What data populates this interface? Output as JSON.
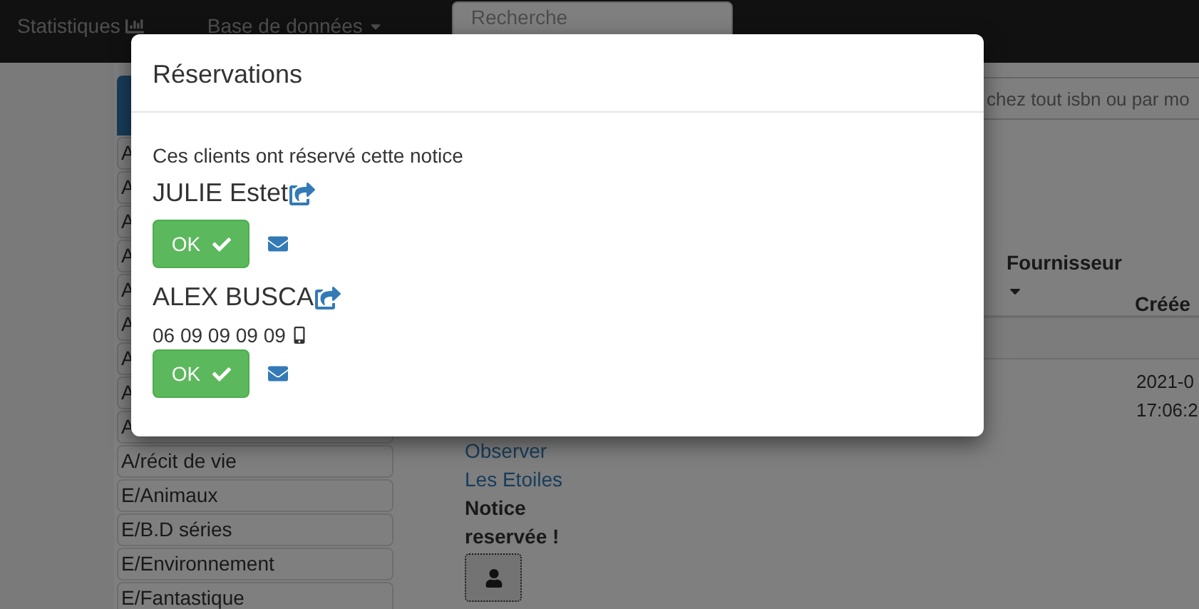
{
  "navbar": {
    "items": [
      {
        "label": "Statistiques",
        "kind": "chart"
      },
      {
        "label": "Base de données",
        "kind": "dropdown"
      }
    ],
    "search": {
      "placeholder": "Recherche"
    }
  },
  "sidebar": {
    "items": [
      {
        "label": "A"
      },
      {
        "label": "A"
      },
      {
        "label": "A"
      },
      {
        "label": "A"
      },
      {
        "label": "A"
      },
      {
        "label": "A"
      },
      {
        "label": "A"
      },
      {
        "label": "A"
      },
      {
        "label": "A"
      },
      {
        "label": "A/récit de vie"
      },
      {
        "label": "E/Animaux"
      },
      {
        "label": "E/B.D séries"
      },
      {
        "label": "E/Environnement"
      },
      {
        "label": "E/Fantastique"
      }
    ]
  },
  "main": {
    "search": {
      "placeholder": "chez tout isbn ou par mo"
    },
    "table": {
      "columns": [
        {
          "label": "Fournisseur",
          "caret": true
        },
        {
          "label": "Créée",
          "caret": false
        }
      ],
      "rows": [
        {
          "links": [
            "Observer",
            "Les Etoiles"
          ],
          "note": "Notice reservée !",
          "created": [
            "2021-0",
            "17:06:2"
          ]
        }
      ]
    }
  },
  "modal": {
    "title": "Réservations",
    "intro": "Ces clients ont réservé cette notice",
    "clients": [
      {
        "name": "JULIE Estet",
        "ok": "OK"
      },
      {
        "name": "ALEX BUSCA",
        "phone": "06 09 09 09 09",
        "ok": "OK"
      }
    ]
  }
}
